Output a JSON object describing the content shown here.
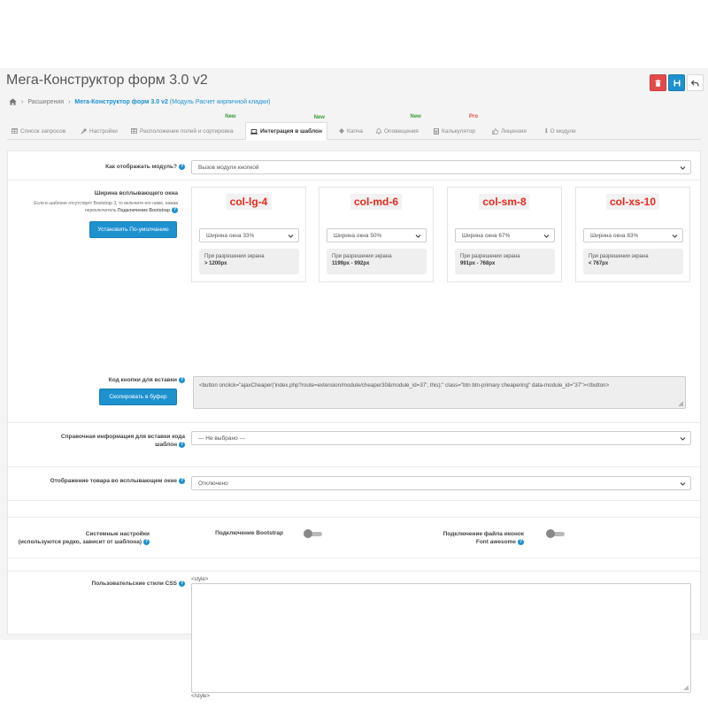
{
  "header": {
    "title": "Мега-Конструктор форм 3.0 v2",
    "delete_icon": "trash-icon",
    "save_icon": "floppy-icon",
    "back_icon": "undo-icon"
  },
  "breadcrumb": {
    "home_icon": "home-icon",
    "item1": "Расширения",
    "item2_bold": "Мега-Конструктор форм 3.0 v2",
    "item2_rest": " (Модуль Расчет кирпичной кладки)"
  },
  "tabs": [
    {
      "label": "Список запросов",
      "icon": "table-icon",
      "badge": ""
    },
    {
      "label": "Настройки",
      "icon": "wrench-icon",
      "badge": ""
    },
    {
      "label": "Расположение полей и сортировка",
      "icon": "table-icon",
      "badge": "New"
    },
    {
      "label": "Интеграция в шаблон",
      "icon": "laptop-icon",
      "badge": "New"
    },
    {
      "label": "Капча",
      "icon": "diamond-icon",
      "badge": ""
    },
    {
      "label": "Оповещения",
      "icon": "bell-icon",
      "badge": "New"
    },
    {
      "label": "Калькулятор",
      "icon": "calculator-icon",
      "badge": "Pro"
    },
    {
      "label": "Лицензия",
      "icon": "thumbs-up-icon",
      "badge": ""
    },
    {
      "label": "О модуле",
      "icon": "info-icon",
      "badge": ""
    }
  ],
  "display": {
    "label": "Как отображать модуль?",
    "value": "Вызов модуля кнопкой"
  },
  "popup_width": {
    "label": "Ширина всплывающего окна",
    "note": "Если в шаблоне отсутствует Bootstrap 3, то включите его ниже, нажав переключатель",
    "note_bold": "Подключение Bootstrap",
    "reset_button": "Установить По-умолчанию",
    "cols": [
      {
        "tag": "col-lg-4",
        "select": "Ширина окна 33%",
        "res_label": "При разрешении экрана",
        "res_value": "> 1200px"
      },
      {
        "tag": "col-md-6",
        "select": "Ширина окна 50%",
        "res_label": "При разрешении экрана",
        "res_value": "1199px - 992px"
      },
      {
        "tag": "col-sm-8",
        "select": "Ширина окна 67%",
        "res_label": "При разрешении экрана",
        "res_value": "991px - 768px"
      },
      {
        "tag": "col-xs-10",
        "select": "Ширина окна 83%",
        "res_label": "При разрешении экрана",
        "res_value": "< 767px"
      }
    ]
  },
  "button_code": {
    "label": "Код кнопки для вставки",
    "copy_button": "Скопировать в буфер",
    "code": "<button onclick=\"ajaxCheaper('index.php?route=extension/module/cheaper30&module_id=37', this);\" class=\"btn btn-primary cheapering\" data-module_id=\"37\"></button>"
  },
  "reference": {
    "label_line1": "Справочная информация для вставки кода",
    "label_line2": "шаблон",
    "value": "--- Не выбрано ---"
  },
  "product_display": {
    "label": "Отображение товара во всплывающем окне",
    "value": "Отключено"
  },
  "system": {
    "label_line1": "Системные настройки",
    "label_line2": "(используются редко, зависит от шаблона)",
    "bootstrap_label": "Подключение Bootstrap",
    "fa_label_line1": "Подключение файла иконок",
    "fa_label_line2": "Font awesome",
    "bootstrap_on": false,
    "fa_on": false
  },
  "css": {
    "label": "Пользовательские стили CSS",
    "open_tag": "<style>",
    "close_tag": "</style>",
    "value": ""
  }
}
